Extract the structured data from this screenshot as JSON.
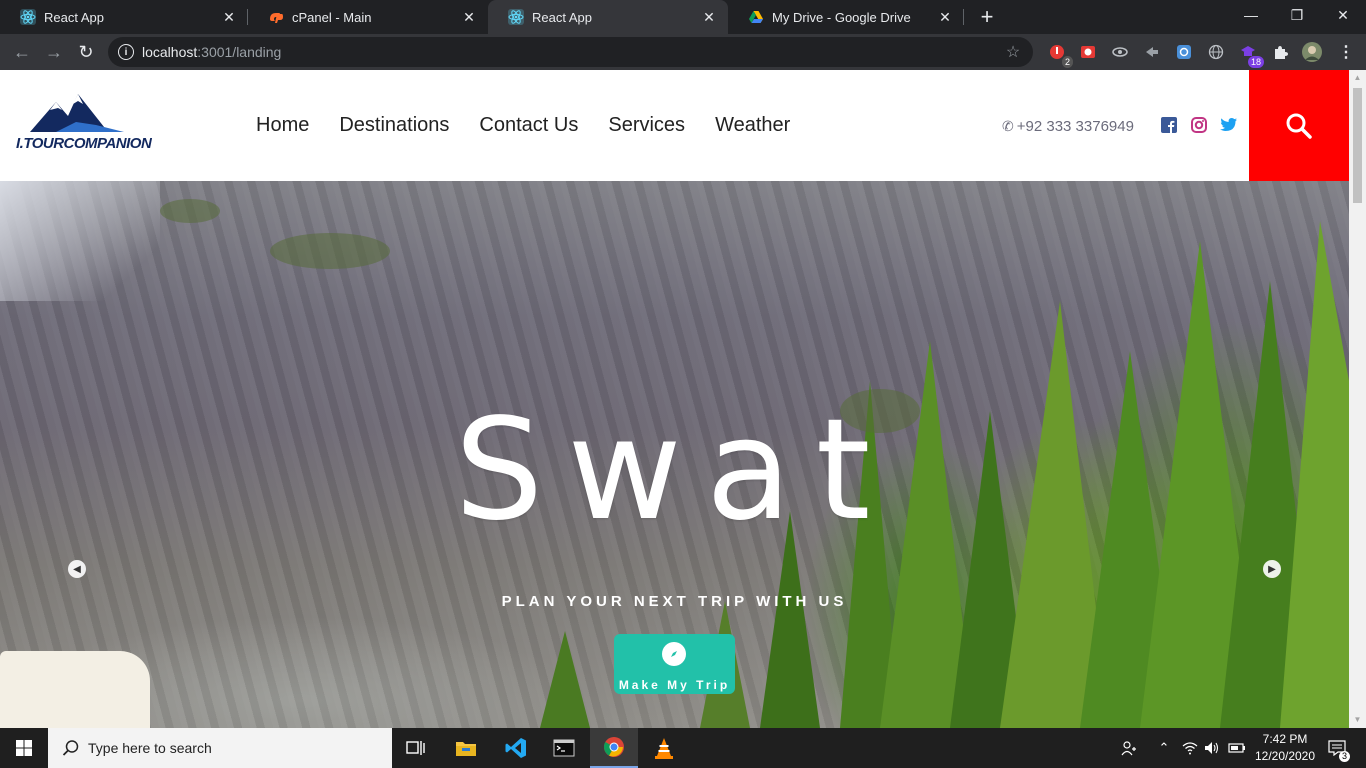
{
  "browser": {
    "tabs": [
      {
        "title": "React App",
        "icon": "react-icon",
        "active": false
      },
      {
        "title": "cPanel - Main",
        "icon": "cpanel-icon",
        "active": false
      },
      {
        "title": "React App",
        "icon": "react-icon",
        "active": true
      },
      {
        "title": "My Drive - Google Drive",
        "icon": "google-drive-icon",
        "active": false
      }
    ],
    "url_host": "localhost",
    "url_path": ":3001/landing",
    "extension_badges": {
      "first": "2",
      "second": "18"
    }
  },
  "site": {
    "logo_text": "I.TOURCOMPANION",
    "nav": [
      "Home",
      "Destinations",
      "Contact Us",
      "Services",
      "Weather"
    ],
    "phone": "+92 333 3376949",
    "accent_color": "#ff0000",
    "hero": {
      "title": "Swat",
      "subtitle": "PLAN YOUR NEXT TRIP WITH US",
      "cta_label": "Make My Trip",
      "cta_color": "#22c1a9"
    }
  },
  "taskbar": {
    "search_placeholder": "Type here to search",
    "time": "7:42 PM",
    "date": "12/20/2020",
    "notifications": "3"
  }
}
